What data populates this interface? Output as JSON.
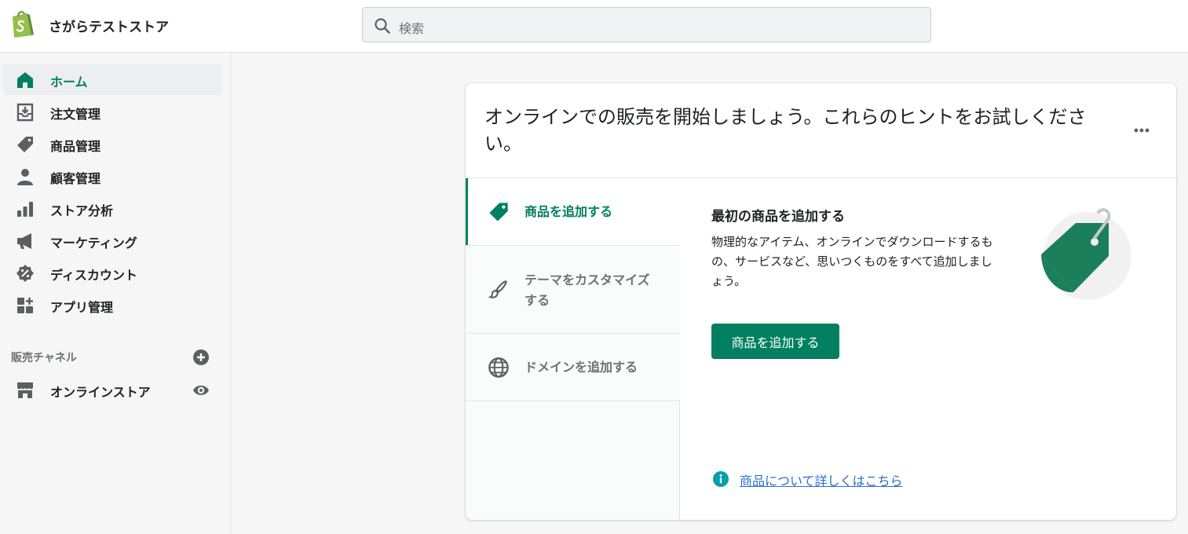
{
  "topbar": {
    "store_name": "さがらテストストア",
    "search_placeholder": "検索"
  },
  "sidebar": {
    "items": [
      {
        "label": "ホーム",
        "icon": "home-icon",
        "active": true
      },
      {
        "label": "注文管理",
        "icon": "orders-icon"
      },
      {
        "label": "商品管理",
        "icon": "tag-icon"
      },
      {
        "label": "顧客管理",
        "icon": "person-icon"
      },
      {
        "label": "ストア分析",
        "icon": "analytics-icon"
      },
      {
        "label": "マーケティング",
        "icon": "megaphone-icon"
      },
      {
        "label": "ディスカウント",
        "icon": "discount-icon"
      },
      {
        "label": "アプリ管理",
        "icon": "apps-icon"
      }
    ],
    "sales_channels": {
      "title": "販売チャネル",
      "items": [
        {
          "label": "オンラインストア",
          "icon": "store-icon"
        }
      ]
    }
  },
  "card": {
    "title": "オンラインでの販売を開始しましょう。これらのヒントをお試しください。",
    "tabs": [
      {
        "label": "商品を追加する",
        "icon": "tag-icon",
        "active": true
      },
      {
        "label": "テーマをカスタマイズする",
        "icon": "brush-icon"
      },
      {
        "label": "ドメインを追加する",
        "icon": "globe-icon"
      }
    ],
    "detail": {
      "title": "最初の商品を追加する",
      "description": "物理的なアイテム、オンラインでダウンロードするもの、サービスなど、思いつくものをすべて追加しましょう。",
      "button": "商品を追加する",
      "link": "商品について詳しくはこちら"
    }
  },
  "colors": {
    "accent": "#008060",
    "link": "#2c6ecb",
    "logo": "#95bf47"
  }
}
